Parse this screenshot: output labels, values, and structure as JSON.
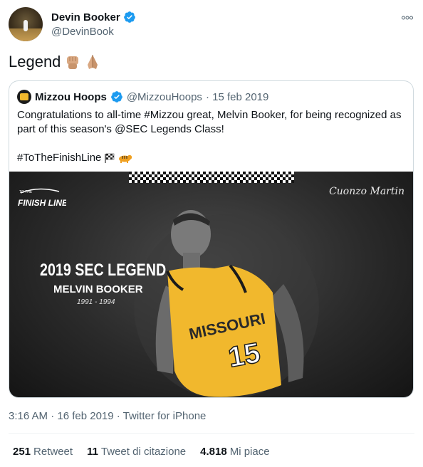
{
  "tweet": {
    "author_name": "Devin Booker",
    "author_handle": "@DevinBook",
    "text": "Legend",
    "emojis": [
      "raised-fist-emoji",
      "folded-hands-emoji"
    ],
    "more_icon": "more-icon",
    "timestamp": "3:16 AM · 16 feb 2019 · Twitter for iPhone"
  },
  "quote": {
    "name": "Mizzou Hoops",
    "handle": "@MizzouHoops",
    "date": "· 15 feb 2019",
    "text": "Congratulations to all-time #Mizzou great, Melvin Booker, for being recognized as part of this season's @SEC Legends Class!",
    "hashtag": "#ToTheFinishLine",
    "hashtag_emojis": [
      "checkered-flag-emoji",
      "tiger-emoji"
    ],
    "image": {
      "logo_text": "FINISH LINE",
      "logo_small_text": "TO THE",
      "signature": "Cuonzo Martin",
      "title": "2019 SEC LEGEND",
      "name": "MELVIN BOOKER",
      "years": "1991 - 1994",
      "jersey_text": "MISSOURI",
      "jersey_number": "15"
    }
  },
  "stats": [
    {
      "num": "251",
      "label": "Retweet"
    },
    {
      "num": "11",
      "label": "Tweet di citazione"
    },
    {
      "num": "4.818",
      "label": "Mi piace"
    }
  ],
  "colors": {
    "verified": "#1d9bf0",
    "secondary_text": "#536471",
    "border": "#cfd9de",
    "jersey_gold": "#f1b82d"
  }
}
